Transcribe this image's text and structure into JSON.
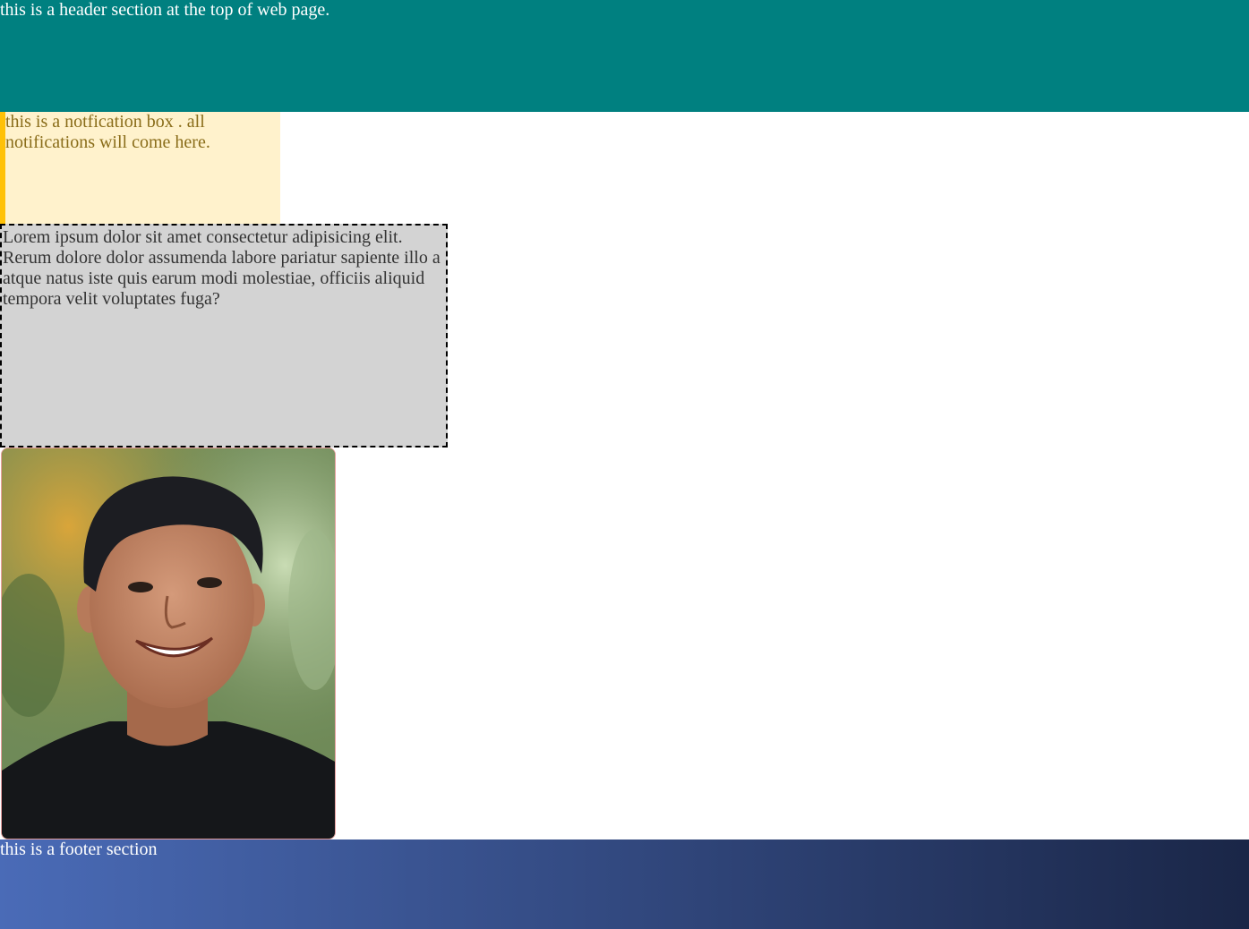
{
  "header": {
    "text": "this is a header section at the top of web page."
  },
  "notification": {
    "text": "this is a notfication box . all notifications will come here."
  },
  "content": {
    "text": "Lorem ipsum dolor sit amet consectetur adipisicing elit. Rerum dolore dolor assumenda labore pariatur sapiente illo a atque natus iste quis earum modi molestiae, officiis aliquid tempora velit voluptates fuga?"
  },
  "footer": {
    "text": "this is a footer section"
  },
  "colors": {
    "header_bg": "#008080",
    "notification_bg": "#fff2cc",
    "notification_border": "#ffc107",
    "content_bg": "#d3d3d3",
    "footer_gradient_start": "#4a6bb7",
    "footer_gradient_end": "#1a2647"
  }
}
